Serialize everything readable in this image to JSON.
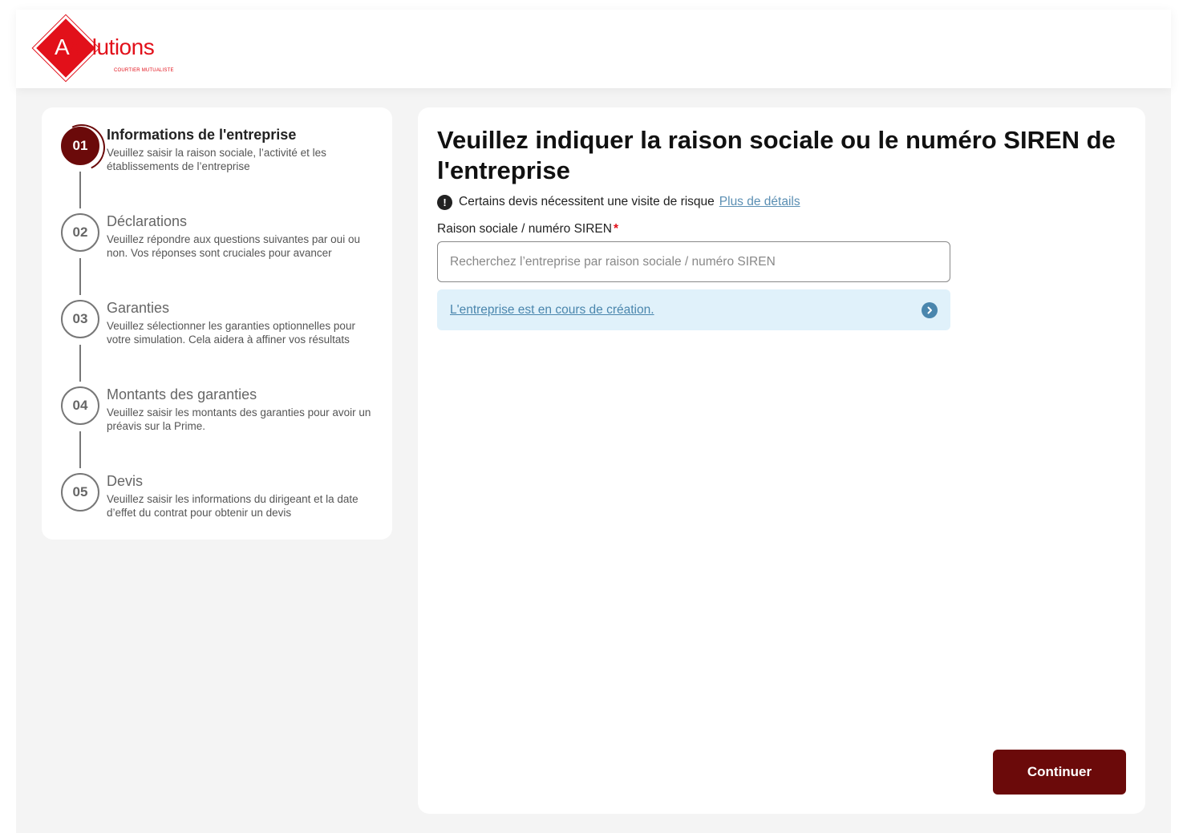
{
  "header": {
    "logo_text_a": "A",
    "logo_text_rest": "solutions",
    "logo_subtitle": "COURTIER MUTUALISTE",
    "brand_color": "#e2101a"
  },
  "stepper": {
    "active_color": "#6b0a0a",
    "steps": [
      {
        "number": "01",
        "title": "Informations de l'entreprise",
        "desc": " Veuillez saisir la raison sociale, l’activité et les établissements de l’entreprise",
        "active": true
      },
      {
        "number": "02",
        "title": "Déclarations",
        "desc": "Veuillez répondre aux questions suivantes par oui ou non. Vos réponses sont cruciales pour avancer",
        "active": false
      },
      {
        "number": "03",
        "title": "Garanties",
        "desc": "Veuillez sélectionner les garanties optionnelles pour votre simulation. Cela  aidera à affiner vos résultats",
        "active": false
      },
      {
        "number": "04",
        "title": "Montants des garanties",
        "desc": "Veuillez saisir les montants des garanties pour avoir un préavis sur la Prime.",
        "active": false
      },
      {
        "number": "05",
        "title": "Devis",
        "desc": "Veuillez saisir les informations du dirigeant et la date d’effet du contrat pour obtenir un devis",
        "active": false
      }
    ]
  },
  "main": {
    "title": "Veuillez indiquer la raison sociale ou le numéro SIREN de l'entreprise",
    "notice_icon": "!",
    "notice_text": "Certains devis nécessitent une visite de risque",
    "notice_link": "Plus de détails",
    "field_label": "Raison sociale / numéro SIREN",
    "required_mark": "*",
    "search_value": "",
    "search_placeholder": "Recherchez l’entreprise par raison sociale / numéro SIREN",
    "creation_link": "L'entreprise est en cours de création.",
    "continue_label": "Continuer"
  }
}
